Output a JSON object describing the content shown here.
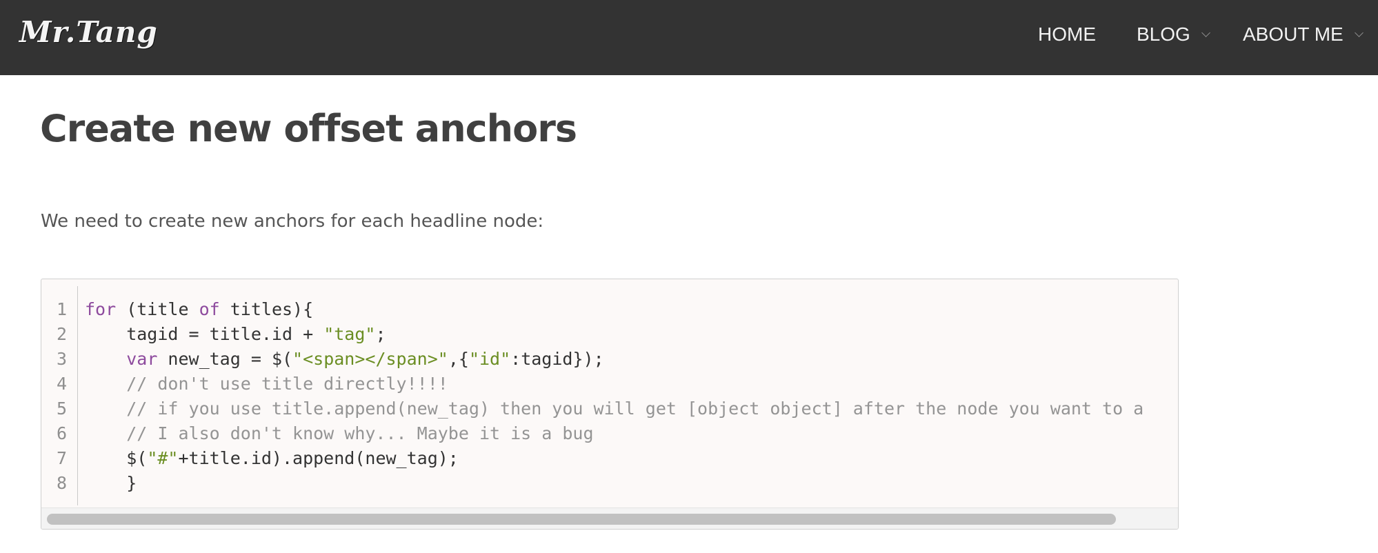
{
  "header": {
    "brand": "Mr.Tang",
    "nav": {
      "home": "HOME",
      "blog": "BLOG",
      "about": "ABOUT ME"
    }
  },
  "main": {
    "title": "Create new offset anchors",
    "intro": "We need to create new anchors for each headline node:"
  },
  "code": {
    "line_numbers": [
      "1",
      "2",
      "3",
      "4",
      "5",
      "6",
      "7",
      "8"
    ],
    "lines": {
      "l1": {
        "kw_for": "for",
        "p1": " (title ",
        "kw_of": "of",
        "p2": " titles){"
      },
      "l2": {
        "p1": "    tagid = title.id + ",
        "s1": "\"tag\"",
        "p2": ";"
      },
      "l3": {
        "p0": "    ",
        "kw_var": "var",
        "p1": " new_tag = $(",
        "s1": "\"<span></span>\"",
        "p2": ",{",
        "s2": "\"id\"",
        "p3": ":tagid});"
      },
      "l4": {
        "comment": "    // don't use title directly!!!!"
      },
      "l5": {
        "comment": "    // if you use title.append(new_tag) then you will get [object object] after the node you want to a"
      },
      "l6": {
        "comment": "    // I also don't know why... Maybe it is a bug"
      },
      "l7": {
        "p1": "    $(",
        "s1": "\"#\"",
        "p2": "+title.id).append(new_tag);"
      },
      "l8": {
        "p1": "    }"
      }
    }
  },
  "colors": {
    "navbar_bg": "#333333",
    "keyword": "#8e4b9e",
    "string": "#6b8e23",
    "comment": "#949494",
    "code_bg": "#fcf9f8"
  }
}
